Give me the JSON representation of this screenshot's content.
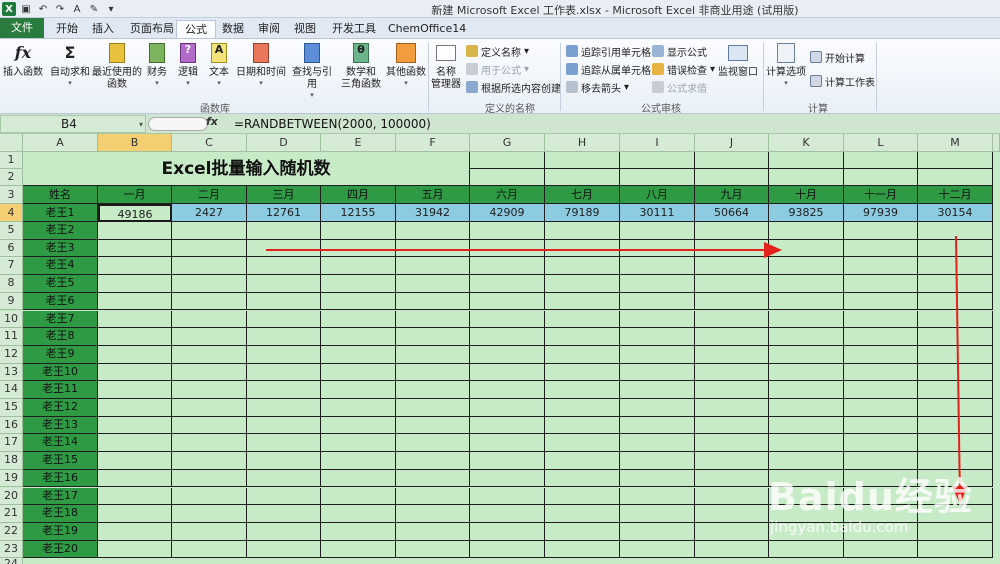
{
  "window": {
    "title": "新建 Microsoft Excel 工作表.xlsx - Microsoft Excel 非商业用途 (试用版)"
  },
  "tabs": [
    "文件",
    "开始",
    "插入",
    "页面布局",
    "公式",
    "数据",
    "审阅",
    "视图",
    "开发工具",
    "ChemOffice14"
  ],
  "ribbon": {
    "function_library": {
      "label": "函数库",
      "buttons": [
        "插入函数",
        "自动求和",
        "最近使用的\n函数",
        "财务",
        "逻辑",
        "文本",
        "日期和时间",
        "查找与引用",
        "数学和\n三角函数",
        "其他函数"
      ]
    },
    "defined_names": {
      "label": "定义的名称",
      "manager": "名称\n管理器",
      "define_name": "定义名称",
      "use_in_formula": "用于公式",
      "create_from_selection": "根据所选内容创建"
    },
    "formula_auditing": {
      "label": "公式审核",
      "trace_precedents": "追踪引用单元格",
      "trace_dependents": "追踪从属单元格",
      "remove_arrows": "移去箭头",
      "show_formulas": "显示公式",
      "error_checking": "错误检查",
      "evaluate_formula": "公式求值",
      "watch_window": "监视窗口"
    },
    "calculation": {
      "label": "计算",
      "options": "计算选项",
      "calc_now": "开始计算",
      "calc_sheet": "计算工作表"
    }
  },
  "formula_bar": {
    "name_box": "B4",
    "fx": "fx",
    "formula": "=RANDBETWEEN(2000, 100000)"
  },
  "columns": [
    "A",
    "B",
    "C",
    "D",
    "E",
    "F",
    "G",
    "H",
    "I",
    "J",
    "K",
    "L",
    "M"
  ],
  "sheet": {
    "title": "Excel批量输入随机数",
    "header_name": "姓名",
    "months": [
      "一月",
      "二月",
      "三月",
      "四月",
      "五月",
      "六月",
      "七月",
      "八月",
      "九月",
      "十月",
      "十一月",
      "十二月"
    ],
    "row4_values": [
      "49186",
      "2427",
      "12761",
      "12155",
      "31942",
      "42909",
      "79189",
      "30111",
      "50664",
      "93825",
      "97939",
      "30154"
    ],
    "names": [
      "老王1",
      "老王2",
      "老王3",
      "老王4",
      "老王5",
      "老王6",
      "老王7",
      "老王8",
      "老王9",
      "老王10",
      "老王11",
      "老王12",
      "老王13",
      "老王14",
      "老王15",
      "老王16",
      "老王17",
      "老王18",
      "老王19",
      "老王20"
    ]
  },
  "watermark": {
    "brand": "Baidu经验",
    "url": "jingyan.baidu.com"
  },
  "colors": {
    "header_green": "#2e9a44",
    "value_blue": "#8ccbe0",
    "sheet_bg": "#c7eac7",
    "arrow_red": "#e3221c"
  }
}
